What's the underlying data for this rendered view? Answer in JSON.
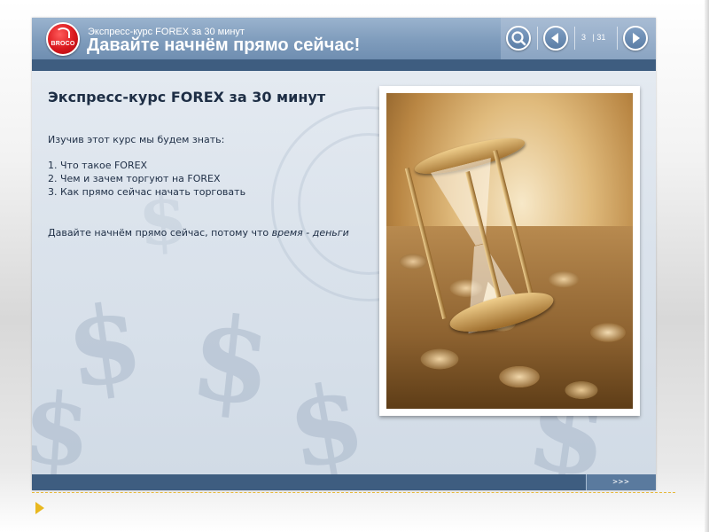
{
  "header": {
    "logo_text": "BROCO",
    "subtitle": "Экспресс-курс FOREX за 30 минут",
    "title": "Давайте начнём прямо сейчас!"
  },
  "navigation": {
    "search_icon": "magnifier-icon",
    "prev_icon": "triangle-left-icon",
    "next_icon": "triangle-right-icon",
    "current_page": "3",
    "separator": "|",
    "total_pages": "31"
  },
  "content": {
    "heading": "Экспресс-курс FOREX за 30 минут",
    "intro": "Изучив этот курс мы будем знать:",
    "items": [
      "1. Что такое FOREX",
      "2. Чем и зачем торгуют на FOREX",
      "3. Как прямо сейчас начать торговать"
    ],
    "closing_prefix": "Давайте начнём прямо сейчас, потому что ",
    "closing_italic": "время - деньги"
  },
  "image": {
    "subject": "hourglass-on-coins-photo"
  },
  "footer": {
    "next_label": ">>>"
  },
  "colors": {
    "header_blue": "#7f9cbc",
    "strip_blue": "#3e5d80",
    "text_dark": "#1e2e45",
    "logo_red": "#d9171c",
    "arrow_yellow": "#e9b81f"
  }
}
